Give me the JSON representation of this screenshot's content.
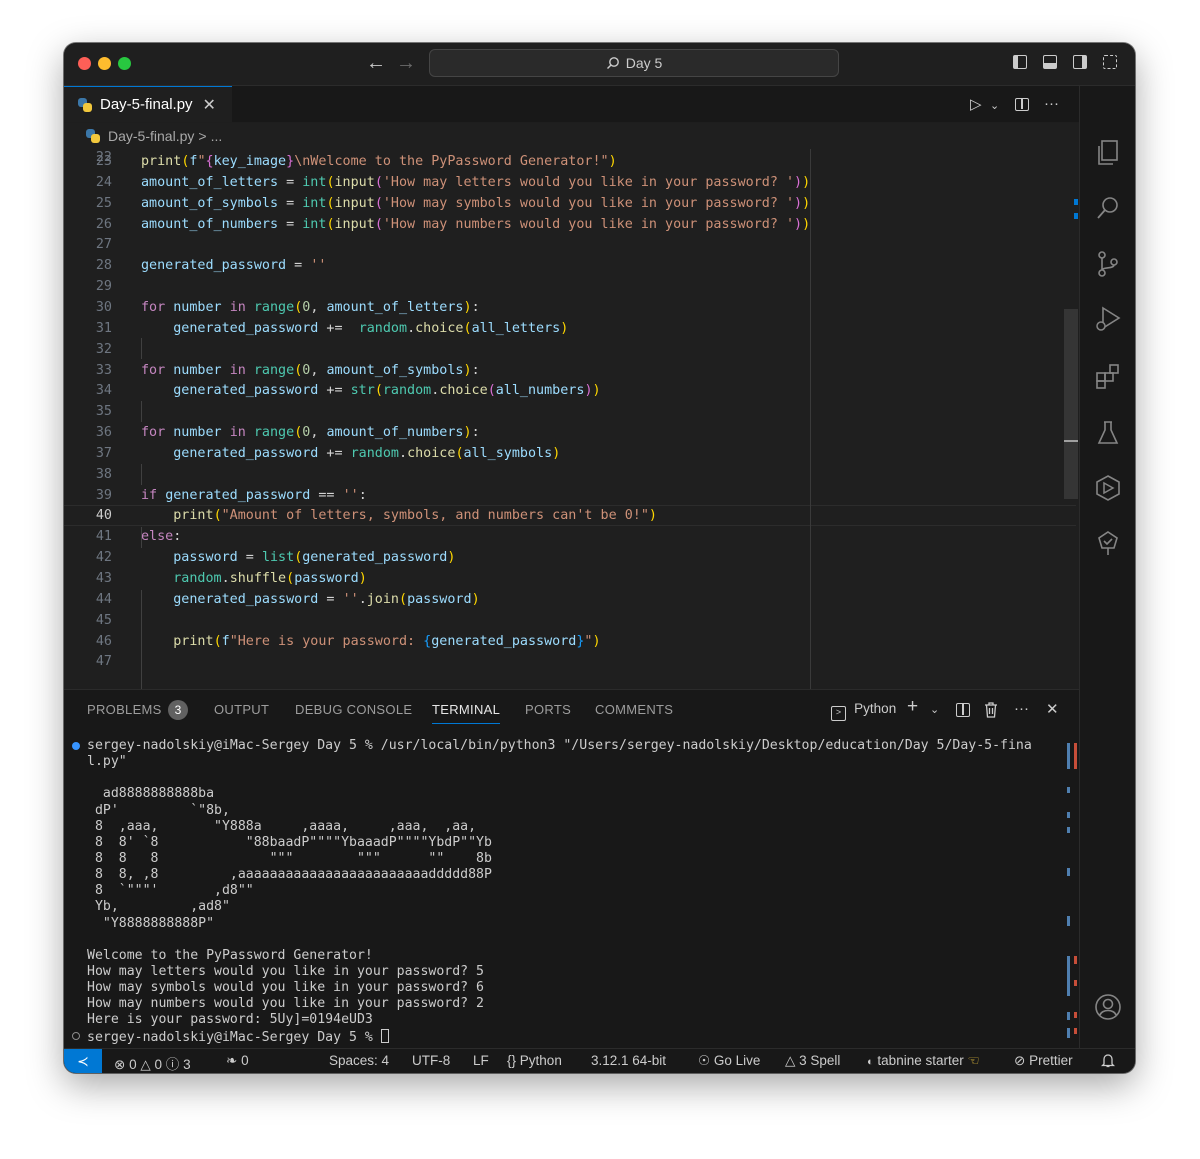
{
  "title": "Day 5",
  "tab": {
    "filename": "Day-5-final.py"
  },
  "breadcrumb": {
    "file": "Day-5-final.py",
    "sep": ">",
    "more": "..."
  },
  "editor": {
    "partial_line_number": "22",
    "lines": [
      {
        "n": "23",
        "c": [
          [
            "fn",
            "print"
          ],
          [
            "br1",
            "("
          ],
          [
            "vr",
            "f"
          ],
          [
            "st",
            "\""
          ],
          [
            "br2",
            "{"
          ],
          [
            "vr",
            "key_image"
          ],
          [
            "br2",
            "}"
          ],
          [
            "st",
            "\\nWelcome to the PyPassword Generator!\""
          ],
          [
            "br1",
            ")"
          ]
        ]
      },
      {
        "n": "24",
        "c": [
          [
            "vr",
            "amount_of_letters"
          ],
          [
            "op",
            " = "
          ],
          [
            "bi",
            "int"
          ],
          [
            "br1",
            "("
          ],
          [
            "fn",
            "input"
          ],
          [
            "br2",
            "("
          ],
          [
            "st",
            "'How may letters would you like in your password? '"
          ],
          [
            "br2",
            ")"
          ],
          [
            "br1",
            ")"
          ]
        ]
      },
      {
        "n": "25",
        "c": [
          [
            "vr",
            "amount_of_symbols"
          ],
          [
            "op",
            " = "
          ],
          [
            "bi",
            "int"
          ],
          [
            "br1",
            "("
          ],
          [
            "fn",
            "input"
          ],
          [
            "br2",
            "("
          ],
          [
            "st",
            "'How may symbols would you like in your password? '"
          ],
          [
            "br2",
            ")"
          ],
          [
            "br1",
            ")"
          ]
        ]
      },
      {
        "n": "26",
        "c": [
          [
            "vr",
            "amount_of_numbers"
          ],
          [
            "op",
            " = "
          ],
          [
            "bi",
            "int"
          ],
          [
            "br1",
            "("
          ],
          [
            "fn",
            "input"
          ],
          [
            "br2",
            "("
          ],
          [
            "st",
            "'How may numbers would you like in your password? '"
          ],
          [
            "br2",
            ")"
          ],
          [
            "br1",
            ")"
          ]
        ]
      },
      {
        "n": "27",
        "c": []
      },
      {
        "n": "28",
        "c": [
          [
            "vr",
            "generated_password"
          ],
          [
            "op",
            " = "
          ],
          [
            "st",
            "''"
          ]
        ]
      },
      {
        "n": "29",
        "c": []
      },
      {
        "n": "30",
        "c": [
          [
            "kw",
            "for"
          ],
          [
            "op",
            " "
          ],
          [
            "vr",
            "number"
          ],
          [
            "op",
            " "
          ],
          [
            "kw",
            "in"
          ],
          [
            "op",
            " "
          ],
          [
            "bi",
            "range"
          ],
          [
            "br1",
            "("
          ],
          [
            "nm",
            "0"
          ],
          [
            "op",
            ", "
          ],
          [
            "vr",
            "amount_of_letters"
          ],
          [
            "br1",
            ")"
          ],
          [
            "op",
            ":"
          ]
        ]
      },
      {
        "n": "31",
        "c": [
          [
            "op",
            "    "
          ],
          [
            "vr",
            "generated_password"
          ],
          [
            "op",
            " +=  "
          ],
          [
            "bi",
            "random"
          ],
          [
            "op",
            "."
          ],
          [
            "fn",
            "choice"
          ],
          [
            "br1",
            "("
          ],
          [
            "vr",
            "all_letters"
          ],
          [
            "br1",
            ")"
          ]
        ]
      },
      {
        "n": "32",
        "c": []
      },
      {
        "n": "33",
        "c": [
          [
            "kw",
            "for"
          ],
          [
            "op",
            " "
          ],
          [
            "vr",
            "number"
          ],
          [
            "op",
            " "
          ],
          [
            "kw",
            "in"
          ],
          [
            "op",
            " "
          ],
          [
            "bi",
            "range"
          ],
          [
            "br1",
            "("
          ],
          [
            "nm",
            "0"
          ],
          [
            "op",
            ", "
          ],
          [
            "vr",
            "amount_of_symbols"
          ],
          [
            "br1",
            ")"
          ],
          [
            "op",
            ":"
          ]
        ]
      },
      {
        "n": "34",
        "c": [
          [
            "op",
            "    "
          ],
          [
            "vr",
            "generated_password"
          ],
          [
            "op",
            " += "
          ],
          [
            "bi",
            "str"
          ],
          [
            "br1",
            "("
          ],
          [
            "bi",
            "random"
          ],
          [
            "op",
            "."
          ],
          [
            "fn",
            "choice"
          ],
          [
            "br2",
            "("
          ],
          [
            "vr",
            "all_numbers"
          ],
          [
            "br2",
            ")"
          ],
          [
            "br1",
            ")"
          ]
        ]
      },
      {
        "n": "35",
        "c": []
      },
      {
        "n": "36",
        "c": [
          [
            "kw",
            "for"
          ],
          [
            "op",
            " "
          ],
          [
            "vr",
            "number"
          ],
          [
            "op",
            " "
          ],
          [
            "kw",
            "in"
          ],
          [
            "op",
            " "
          ],
          [
            "bi",
            "range"
          ],
          [
            "br1",
            "("
          ],
          [
            "nm",
            "0"
          ],
          [
            "op",
            ", "
          ],
          [
            "vr",
            "amount_of_numbers"
          ],
          [
            "br1",
            ")"
          ],
          [
            "op",
            ":"
          ]
        ]
      },
      {
        "n": "37",
        "c": [
          [
            "op",
            "    "
          ],
          [
            "vr",
            "generated_password"
          ],
          [
            "op",
            " += "
          ],
          [
            "bi",
            "random"
          ],
          [
            "op",
            "."
          ],
          [
            "fn",
            "choice"
          ],
          [
            "br1",
            "("
          ],
          [
            "vr",
            "all_symbols"
          ],
          [
            "br1",
            ")"
          ]
        ]
      },
      {
        "n": "38",
        "c": []
      },
      {
        "n": "39",
        "c": [
          [
            "kw",
            "if"
          ],
          [
            "op",
            " "
          ],
          [
            "vr",
            "generated_password"
          ],
          [
            "op",
            " == "
          ],
          [
            "st",
            "''"
          ],
          [
            "op",
            ":"
          ]
        ]
      },
      {
        "n": "40",
        "c": [
          [
            "op",
            "    "
          ],
          [
            "fn",
            "print"
          ],
          [
            "br1",
            "("
          ],
          [
            "st",
            "\"Amount of letters, symbols, and numbers can't be 0!\""
          ],
          [
            "br1",
            ")"
          ]
        ]
      },
      {
        "n": "41",
        "c": [
          [
            "kw",
            "else"
          ],
          [
            "op",
            ":"
          ]
        ]
      },
      {
        "n": "42",
        "c": [
          [
            "op",
            "    "
          ],
          [
            "vr",
            "password"
          ],
          [
            "op",
            " = "
          ],
          [
            "bi",
            "list"
          ],
          [
            "br1",
            "("
          ],
          [
            "vr",
            "generated_password"
          ],
          [
            "br1",
            ")"
          ]
        ]
      },
      {
        "n": "43",
        "c": [
          [
            "op",
            "    "
          ],
          [
            "bi",
            "random"
          ],
          [
            "op",
            "."
          ],
          [
            "fn",
            "shuffle"
          ],
          [
            "br1",
            "("
          ],
          [
            "vr",
            "password"
          ],
          [
            "br1",
            ")"
          ]
        ]
      },
      {
        "n": "44",
        "c": [
          [
            "op",
            "    "
          ],
          [
            "vr",
            "generated_password"
          ],
          [
            "op",
            " = "
          ],
          [
            "st",
            "''"
          ],
          [
            "op",
            "."
          ],
          [
            "fn",
            "join"
          ],
          [
            "br1",
            "("
          ],
          [
            "vr",
            "password"
          ],
          [
            "br1",
            ")"
          ]
        ]
      },
      {
        "n": "45",
        "c": []
      },
      {
        "n": "46",
        "c": [
          [
            "op",
            "    "
          ],
          [
            "fn",
            "print"
          ],
          [
            "br1",
            "("
          ],
          [
            "vr",
            "f"
          ],
          [
            "st",
            "\"Here is your password: "
          ],
          [
            "br3",
            "{"
          ],
          [
            "vr",
            "generated_password"
          ],
          [
            "br3",
            "}"
          ],
          [
            "st",
            "\""
          ],
          [
            "br1",
            ")"
          ]
        ]
      },
      {
        "n": "47",
        "c": []
      }
    ]
  },
  "panel": {
    "tabs": [
      "PROBLEMS",
      "OUTPUT",
      "DEBUG CONSOLE",
      "TERMINAL",
      "PORTS",
      "COMMENTS"
    ],
    "problems_count": "3",
    "terminal_profile": "Python"
  },
  "terminal": {
    "lines": [
      "sergey-nadolskiy@iMac-Sergey Day 5 % /usr/local/bin/python3 \"/Users/sergey-nadolskiy/Desktop/education/Day 5/Day-5-fina",
      "l.py\"",
      "",
      "  ad8888888888ba",
      " dP'         `\"8b,",
      " 8  ,aaa,       \"Y888a     ,aaaa,     ,aaa,  ,aa,",
      " 8  8' `8           \"88baadP\"\"\"\"YbaaadP\"\"\"\"YbdP\"\"Yb",
      " 8  8   8              \"\"\"        \"\"\"      \"\"    8b",
      " 8  8, ,8         ,aaaaaaaaaaaaaaaaaaaaaaaaddddd88P",
      " 8  `\"\"\"'       ,d8\"\"",
      " Yb,         ,ad8\"",
      "  \"Y8888888888P\"",
      "",
      "Welcome to the PyPassword Generator!",
      "How may letters would you like in your password? 5",
      "How may symbols would you like in your password? 6",
      "How may numbers would you like in your password? 2",
      "Here is your password: 5Uy]=0194eUD3",
      "sergey-nadolskiy@iMac-Sergey Day 5 % "
    ]
  },
  "statusbar": {
    "errors": "0",
    "warnings": "0",
    "infos": "3",
    "ports": "0",
    "spaces": "Spaces: 4",
    "encoding": "UTF-8",
    "eol": "LF",
    "language": "Python",
    "interpreter": "3.12.1 64-bit",
    "golive": "Go Live",
    "spell": "3 Spell",
    "tabnine": "tabnine starter",
    "prettier": "Prettier"
  },
  "colors": {
    "accent": "#0078d4",
    "bg": "#1e1e1e",
    "keyword": "#c586c0",
    "function": "#dcdcaa",
    "string": "#ce9178"
  }
}
